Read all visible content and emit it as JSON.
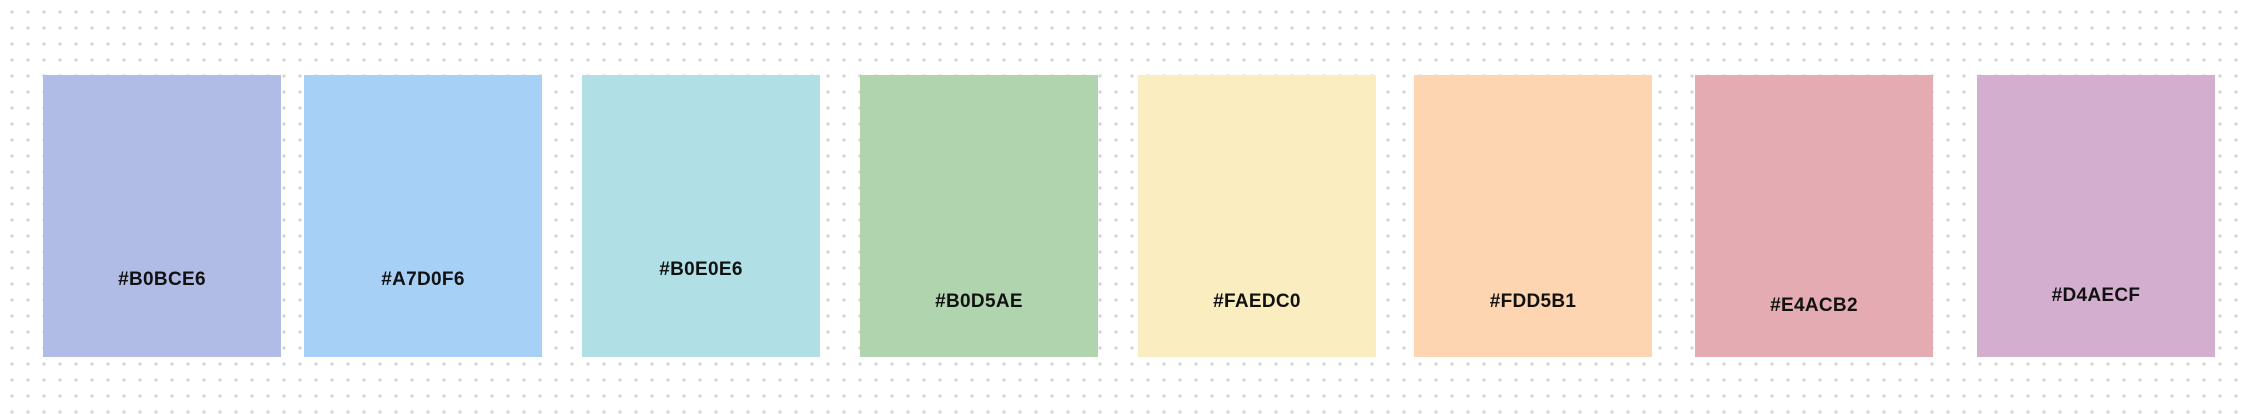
{
  "palette": {
    "swatches": [
      {
        "label": "#B0BCE6",
        "color": "#B0BCE6"
      },
      {
        "label": "#A7D0F6",
        "color": "#A7D0F6"
      },
      {
        "label": "#B0E0E6",
        "color": "#B0E0E6"
      },
      {
        "label": "#B0D5AE",
        "color": "#B0D5AE"
      },
      {
        "label": "#FAEDC0",
        "color": "#FAEDC0"
      },
      {
        "label": "#FDD5B1",
        "color": "#FDD5B1"
      },
      {
        "label": "#E4ACB2",
        "color": "#E4ACB2"
      },
      {
        "label": "#D4AECF",
        "color": "#D4AECF"
      }
    ]
  }
}
